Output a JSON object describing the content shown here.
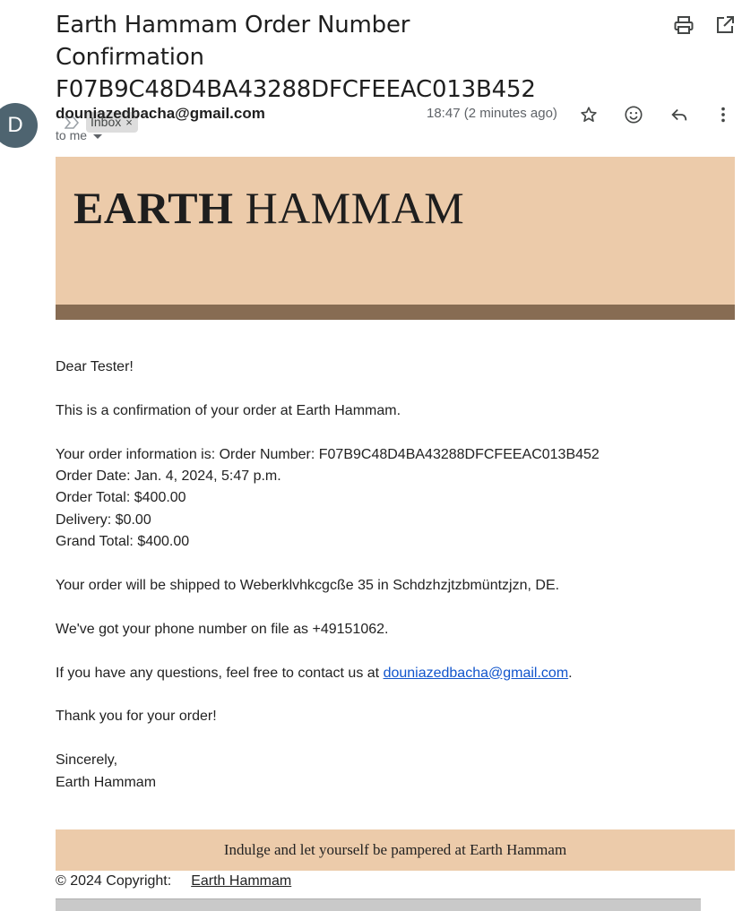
{
  "email": {
    "subject": "Earth Hammam Order Number Confirmation F07B9C48D4BA43288DFCFEEAC013B452",
    "label_chip": "Inbox",
    "label_remove": "×",
    "avatar_letter": "D",
    "sender": "douniazedbacha@gmail.com",
    "recipient": "to me",
    "time": "18:47 (2 minutes ago)"
  },
  "icons": {
    "print": "print-icon",
    "open_new": "open-in-new-icon",
    "importance": "importance-marker-icon",
    "star": "star-icon",
    "emoji": "emoji-reaction-icon",
    "reply": "reply-icon",
    "more": "more-vert-icon"
  },
  "banner": {
    "brand_bold": "EARTH",
    "brand_rest": " HAMMAM",
    "bg_color": "#eccbaa",
    "strip_color": "#876c53"
  },
  "body": {
    "greeting": "Dear Tester!",
    "intro": "This is a confirmation of your order at Earth Hammam.",
    "order_info": "Your order information is: Order Number: F07B9C48D4BA43288DFCFEEAC013B452",
    "order_date": "Order Date: Jan. 4, 2024, 5:47 p.m.",
    "order_total": "Order Total: $400.00",
    "delivery": "Delivery: $0.00",
    "grand_total": "Grand Total: $400.00",
    "shipping": "Your order will be shipped to Weberklvhkcgcße 35 in Schdzhzjtzbmüntzjzn, DE.",
    "phone": "We've got your phone number on file as +49151062.",
    "contact_prefix": "If you have any questions, feel free to contact us at ",
    "contact_email": "douniazedbacha@gmail.com",
    "contact_suffix": ".",
    "thanks": "Thank you for your order!",
    "signoff": "Sincerely,",
    "signature": "Earth Hammam"
  },
  "footer": {
    "tagline": "Indulge and let yourself be pampered at Earth Hammam",
    "copyright": "© 2024 Copyright:",
    "copyright_link": "Earth Hammam"
  }
}
